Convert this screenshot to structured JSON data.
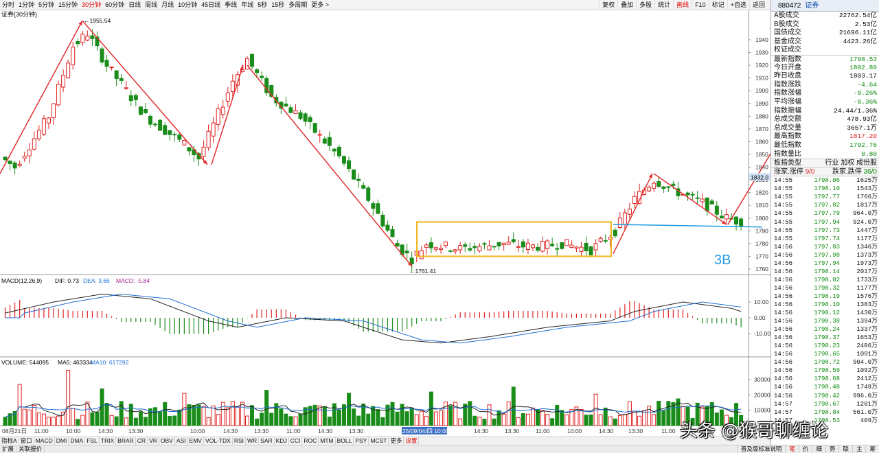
{
  "toolbar": {
    "periods": [
      "分时",
      "1分钟",
      "5分钟",
      "15分钟",
      "30分钟",
      "60分钟",
      "日线",
      "周线",
      "月线",
      "10分钟",
      "45日线",
      "季线",
      "年线",
      "5秒",
      "15秒",
      "多周期",
      "更多 >"
    ],
    "active_period": 4,
    "right_buttons": [
      "复权",
      "叠加",
      "多股",
      "统计",
      "画线",
      "F10",
      "标记",
      "+自选",
      "返回"
    ],
    "right_active": 4
  },
  "chart": {
    "main_label": "证券(30分钟)",
    "price_axis": [
      "1940",
      "1930",
      "1920",
      "1910",
      "1900",
      "1890",
      "1880",
      "1870",
      "1860",
      "1850",
      "1840",
      "1830",
      "1820",
      "1810",
      "1800",
      "1790",
      "1780",
      "1770",
      "1760"
    ],
    "cur_price_tag": "1832.0",
    "high_label": "1955.54",
    "low_label": "1761.41",
    "annotation_3b": "3B",
    "macd_label": "MACD(12,26,9)",
    "macd_dif": "DIF: 0.73",
    "macd_dea": "DEA: 3.66",
    "macd_val": "MACD: -5.84",
    "macd_axis": [
      "10.00",
      "0.00",
      "-10.00"
    ],
    "vol_label": "VOLUME: 544095",
    "vol_ma5": "MA5: 463334",
    "vol_ma10": "MA10: 617292",
    "vol_axis": [
      "30000",
      "20000",
      "10000"
    ],
    "time_labels": [
      "08月21日",
      "11:00",
      "10:00",
      "14:30",
      "13:30",
      "10:00",
      "14:30",
      "13:30",
      "11:00",
      "14:30",
      "13:30",
      "25/09/04/四 10:00",
      "14:30",
      "13:30",
      "11:00",
      "10:00",
      "14:30",
      "13:30",
      "11:00",
      "10:00"
    ]
  },
  "indicator_tabs": [
    "指标A",
    "窗口",
    "MACD",
    "DMI",
    "DMA",
    "FSL",
    "TRIX",
    "BRAR",
    "CR",
    "VR",
    "OBV",
    "ASI",
    "EMV",
    "VOL-TDX",
    "RSI",
    "WR",
    "SAR",
    "KDJ",
    "CCI",
    "ROC",
    "MTM",
    "BOLL",
    "PSY",
    "MCST",
    "更多",
    "设置"
  ],
  "indicator_active": 25,
  "bottom_left": [
    "扩展",
    "关联报价"
  ],
  "bottom_right": [
    "普及版标准说明",
    "笔",
    "价",
    "细",
    "势",
    "联",
    "主",
    "筹"
  ],
  "bottom_right_active": 1,
  "panel": {
    "code": "880472",
    "name": "证券",
    "quote": [
      {
        "k": "A股成交",
        "v": "22762.54亿",
        "c": "black"
      },
      {
        "k": "B股成交",
        "v": "2.53亿",
        "c": "black"
      },
      {
        "k": "国债成交",
        "v": "21696.11亿",
        "c": "black"
      },
      {
        "k": "基金成交",
        "v": "4423.26亿",
        "c": "black"
      },
      {
        "k": "权证成交",
        "v": "",
        "c": "black"
      },
      {
        "k": "最新指数",
        "v": "1798.53",
        "c": "green"
      },
      {
        "k": "今日开盘",
        "v": "1802.89",
        "c": "green"
      },
      {
        "k": "昨日收盘",
        "v": "1803.17",
        "c": "black"
      },
      {
        "k": "指数涨跌",
        "v": "-4.64",
        "c": "green"
      },
      {
        "k": "指数涨幅",
        "v": "-0.26%",
        "c": "green"
      },
      {
        "k": "平均涨幅",
        "v": "-0.36%",
        "c": "green"
      },
      {
        "k": "指数振幅",
        "v": "24.44/1.36%",
        "c": "black"
      },
      {
        "k": "总成交额",
        "v": "478.93亿",
        "c": "black"
      },
      {
        "k": "总成交量",
        "v": "3657.1万",
        "c": "black"
      },
      {
        "k": "最高指数",
        "v": "1817.20",
        "c": "red"
      },
      {
        "k": "最低指数",
        "v": "1792.76",
        "c": "green"
      },
      {
        "k": "指数量比",
        "v": "0.80",
        "c": "green"
      }
    ],
    "type_label": "板指类型",
    "type_value": "行业 加权 成份股",
    "updown_label": "涨家.涨停",
    "updown_value": "9/0",
    "down_label": "跌家.跌停",
    "down_value": "36/0",
    "ticks": [
      {
        "t": "14:55",
        "p": "1798.06",
        "v": "1625万"
      },
      {
        "t": "14:55",
        "p": "1798.10",
        "v": "1543万"
      },
      {
        "t": "14:55",
        "p": "1797.77",
        "v": "1766万"
      },
      {
        "t": "14:55",
        "p": "1797.82",
        "v": "1817万"
      },
      {
        "t": "14:55",
        "p": "1797.79",
        "v": "964.0万"
      },
      {
        "t": "14:55",
        "p": "1797.94",
        "v": "924.0万"
      },
      {
        "t": "14:55",
        "p": "1797.73",
        "v": "1447万"
      },
      {
        "t": "14:55",
        "p": "1797.74",
        "v": "1177万"
      },
      {
        "t": "14:56",
        "p": "1797.83",
        "v": "1346万"
      },
      {
        "t": "14:56",
        "p": "1797.98",
        "v": "1373万"
      },
      {
        "t": "14:56",
        "p": "1797.94",
        "v": "1973万"
      },
      {
        "t": "14:56",
        "p": "1798.14",
        "v": "2017万"
      },
      {
        "t": "14:56",
        "p": "1798.02",
        "v": "1733万"
      },
      {
        "t": "14:56",
        "p": "1798.32",
        "v": "1177万"
      },
      {
        "t": "14:56",
        "p": "1798.19",
        "v": "1576万"
      },
      {
        "t": "14:56",
        "p": "1798.10",
        "v": "1383万"
      },
      {
        "t": "14:56",
        "p": "1798.12",
        "v": "1430万"
      },
      {
        "t": "14:56",
        "p": "1798.38",
        "v": "1394万"
      },
      {
        "t": "14:56",
        "p": "1798.24",
        "v": "1337万"
      },
      {
        "t": "14:56",
        "p": "1798.37",
        "v": "1653万"
      },
      {
        "t": "14:56",
        "p": "1798.23",
        "v": "2406万"
      },
      {
        "t": "14:56",
        "p": "1798.65",
        "v": "1091万"
      },
      {
        "t": "14:56",
        "p": "1798.72",
        "v": "904.0万"
      },
      {
        "t": "14:56",
        "p": "1798.59",
        "v": "1092万"
      },
      {
        "t": "14:56",
        "p": "1798.68",
        "v": "2412万"
      },
      {
        "t": "14:56",
        "p": "1798.48",
        "v": "1749万"
      },
      {
        "t": "14:56",
        "p": "1798.42",
        "v": "996.0万"
      },
      {
        "t": "14:57",
        "p": "1798.67",
        "v": "1201万"
      },
      {
        "t": "14:57",
        "p": "1798.84",
        "v": "561.0万"
      },
      {
        "t": "14:57",
        "p": "1798.53",
        "v": "409万"
      }
    ]
  },
  "watermark": "头条 @猴哥聊缠论",
  "colors": {
    "up": "#e02020",
    "down": "#1a8c1a",
    "box": "#f2b51a",
    "line_blue": "#1e9be0",
    "arrow": "#e03030"
  }
}
